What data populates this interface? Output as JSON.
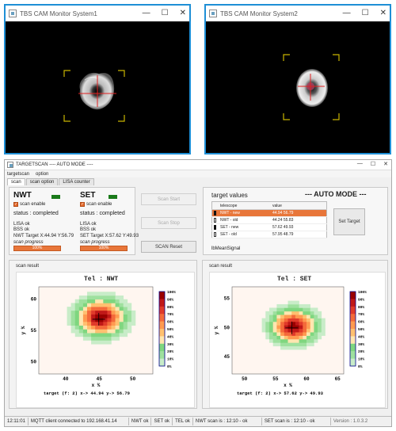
{
  "cam1": {
    "title": "TBS CAM Monitor System1"
  },
  "cam2": {
    "title": "TBS CAM Monitor System2"
  },
  "window": {
    "minimize": "—",
    "maximize": "☐",
    "close": "✕"
  },
  "main": {
    "title": "TARGETSCAN ---- AUTO MODE ----",
    "menu": [
      "targetscan",
      "option"
    ],
    "tabs": [
      "scan",
      "scan option",
      "LISA counter"
    ]
  },
  "nwt": {
    "name": "NWT",
    "scan_enable": "scan enable",
    "status": "status : completed",
    "lisa": "LISA ok",
    "bss": "BSS ok",
    "target": "NWT Target X:44.94 Y:56.79",
    "progress_label": "scan progress",
    "progress_text": "100%",
    "progress": 1.0
  },
  "set": {
    "name": "SET",
    "scan_enable": "scan enable",
    "status": "status : completed",
    "lisa": "LISA ok",
    "bss": "BSS ok",
    "target": "SET Target X:57.62 Y:49.93",
    "progress_label": "scan progress",
    "progress_text": "100%",
    "progress": 1.0
  },
  "controls": {
    "scan_start": "Scan Start",
    "scan_stop": "Scan Stop",
    "scan_reset": "SCAN Reset",
    "set_target": "Set Target"
  },
  "target_values": {
    "title": "target values",
    "mode": "--- AUTO MODE ---",
    "columns": [
      "telescope",
      "value"
    ],
    "rows": [
      {
        "telescope": "NWT - new",
        "value": "44.94 56.79",
        "selected": true
      },
      {
        "telescope": "NWT - old",
        "value": "44.24 55.83",
        "selected": false
      },
      {
        "telescope": "SET - new",
        "value": "57.62 49.93",
        "selected": false
      },
      {
        "telescope": "SET - old",
        "value": "57.95 48.79",
        "selected": false
      }
    ],
    "footer": "lbMeanSignal"
  },
  "scan_result_label": "scan result",
  "chart_data": [
    {
      "type": "heatmap",
      "title": "Tel : NWT",
      "xlabel": "x %",
      "ylabel": "y %",
      "x_ticks": [
        40,
        45,
        50
      ],
      "y_ticks": [
        60,
        55,
        50
      ],
      "xlim": [
        36,
        53
      ],
      "ylim": [
        48,
        62
      ],
      "colorbar_ticks": [
        "100%",
        "90%",
        "80%",
        "70%",
        "60%",
        "50%",
        "40%",
        "30%",
        "20%",
        "10%",
        "0%"
      ],
      "target": {
        "x": 44.94,
        "y": 56.79
      },
      "caption": "target (f: 2) x-> 44.94 y-> 56.79"
    },
    {
      "type": "heatmap",
      "title": "Tel : SET",
      "xlabel": "x %",
      "ylabel": "y %",
      "x_ticks": [
        50,
        55,
        60,
        65
      ],
      "y_ticks": [
        55,
        50,
        45
      ],
      "xlim": [
        48,
        66
      ],
      "ylim": [
        42,
        57
      ],
      "colorbar_ticks": [
        "100%",
        "90%",
        "80%",
        "70%",
        "60%",
        "50%",
        "40%",
        "30%",
        "20%",
        "10%",
        "0%"
      ],
      "target": {
        "x": 57.62,
        "y": 49.93
      },
      "caption": "target (f: 2) x-> 57.62 y-> 49.93"
    }
  ],
  "statusbar": {
    "time": "12:11:01",
    "mqtt": "MQTT client connected to 192.168.41.14",
    "nwt": "NWT ok",
    "set": "SET ok",
    "tel": "TEL ok",
    "nwt_scan": "NWT scan is : 12:10 - ok",
    "set_scan": "SET scan is : 12:10 - ok",
    "version": "Version : 1.0.3.2"
  },
  "colors": {
    "accent": "#e8763a",
    "cam_border": "#1e8fd6",
    "ok_green": "#1a7a1a",
    "bracket": "#c8b400"
  }
}
